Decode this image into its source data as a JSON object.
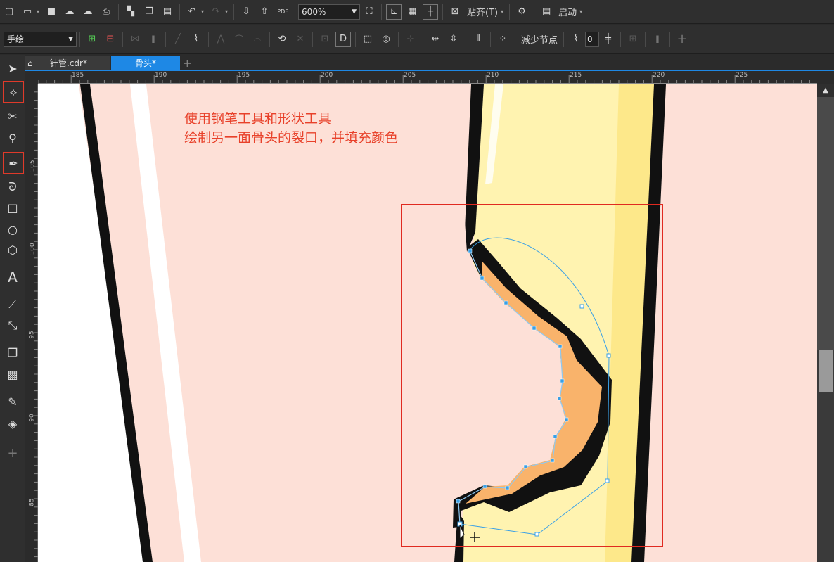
{
  "toolbar_top": {
    "zoom": "600%",
    "snap_label": "贴齐(T)",
    "launch_label": "启动"
  },
  "property_bar": {
    "mode": "手绘",
    "reduce_nodes_label": "减少节点",
    "smoothness_value": "0"
  },
  "tabs": [
    {
      "label": "针管.cdr*",
      "active": false
    },
    {
      "label": "骨头*",
      "active": true
    }
  ],
  "ruler": {
    "h_ticks": [
      "185",
      "190",
      "195",
      "200",
      "205",
      "210",
      "215",
      "220",
      "225"
    ],
    "v_ticks": [
      "105",
      "100",
      "95",
      "90",
      "85"
    ]
  },
  "annotation": {
    "line1": "使用钢笔工具和形状工具",
    "line2": "绘制另一面骨头的裂口，并填充颜色"
  },
  "colors": {
    "canvas_bg": "#fde0d7",
    "bone_fill": "#fff3b0",
    "crack_fill": "#f9b36b",
    "highlight_box": "#e02a20",
    "annotation_text": "#e8412a",
    "tab_active": "#1e88e5"
  },
  "icons": [
    "new-document-icon",
    "open-icon",
    "save-icon",
    "upload-icon",
    "print-icon",
    "undo-icon",
    "redo-icon",
    "import-icon",
    "export-icon",
    "pdf-icon",
    "fullscreen-icon",
    "rulers-icon",
    "grid-icon",
    "guidelines-icon",
    "snap-off-icon",
    "settings-icon",
    "launch-icon",
    "home-icon",
    "pick-tool-icon",
    "shape-tool-icon",
    "crop-tool-icon",
    "zoom-tool-icon",
    "pen-tool-icon",
    "artistic-media-icon",
    "rectangle-tool-icon",
    "ellipse-tool-icon",
    "polygon-tool-icon",
    "text-tool-icon",
    "dimension-tool-icon",
    "connector-tool-icon",
    "drop-shadow-icon",
    "transparency-icon",
    "eyedropper-icon",
    "fill-icon",
    "add-tool-icon"
  ]
}
